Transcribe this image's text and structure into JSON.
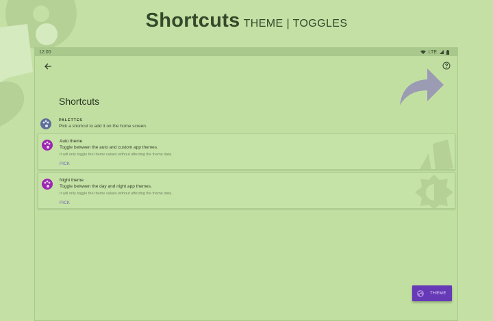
{
  "headline": {
    "title": "Shortcuts",
    "subtitle": "THEME | TOGGLES"
  },
  "status_bar": {
    "time": "12:00",
    "network": "LTE"
  },
  "screen": {
    "title": "Shortcuts"
  },
  "palettes": {
    "label": "PALETTES",
    "description": "Pick a shortcut to add it on the home screen."
  },
  "shortcuts": [
    {
      "title": "Auto theme",
      "subtitle": "Toggle between the auto and custom app themes.",
      "note": "It will only toggle the theme values without affecting the theme data.",
      "action": "PICK",
      "icon": "palette-icon"
    },
    {
      "title": "Night theme",
      "subtitle": "Toggle between the day and night app themes.",
      "note": "It will only toggle the theme values without affecting the theme data.",
      "action": "PICK",
      "icon": "palette-icon"
    }
  ],
  "fab": {
    "label": "THEME",
    "icon": "palette-icon"
  },
  "colors": {
    "background": "#c5e0a5",
    "accent": "#6639b7",
    "palette_icon": "#9c27b0",
    "link": "#6a5fa8"
  }
}
